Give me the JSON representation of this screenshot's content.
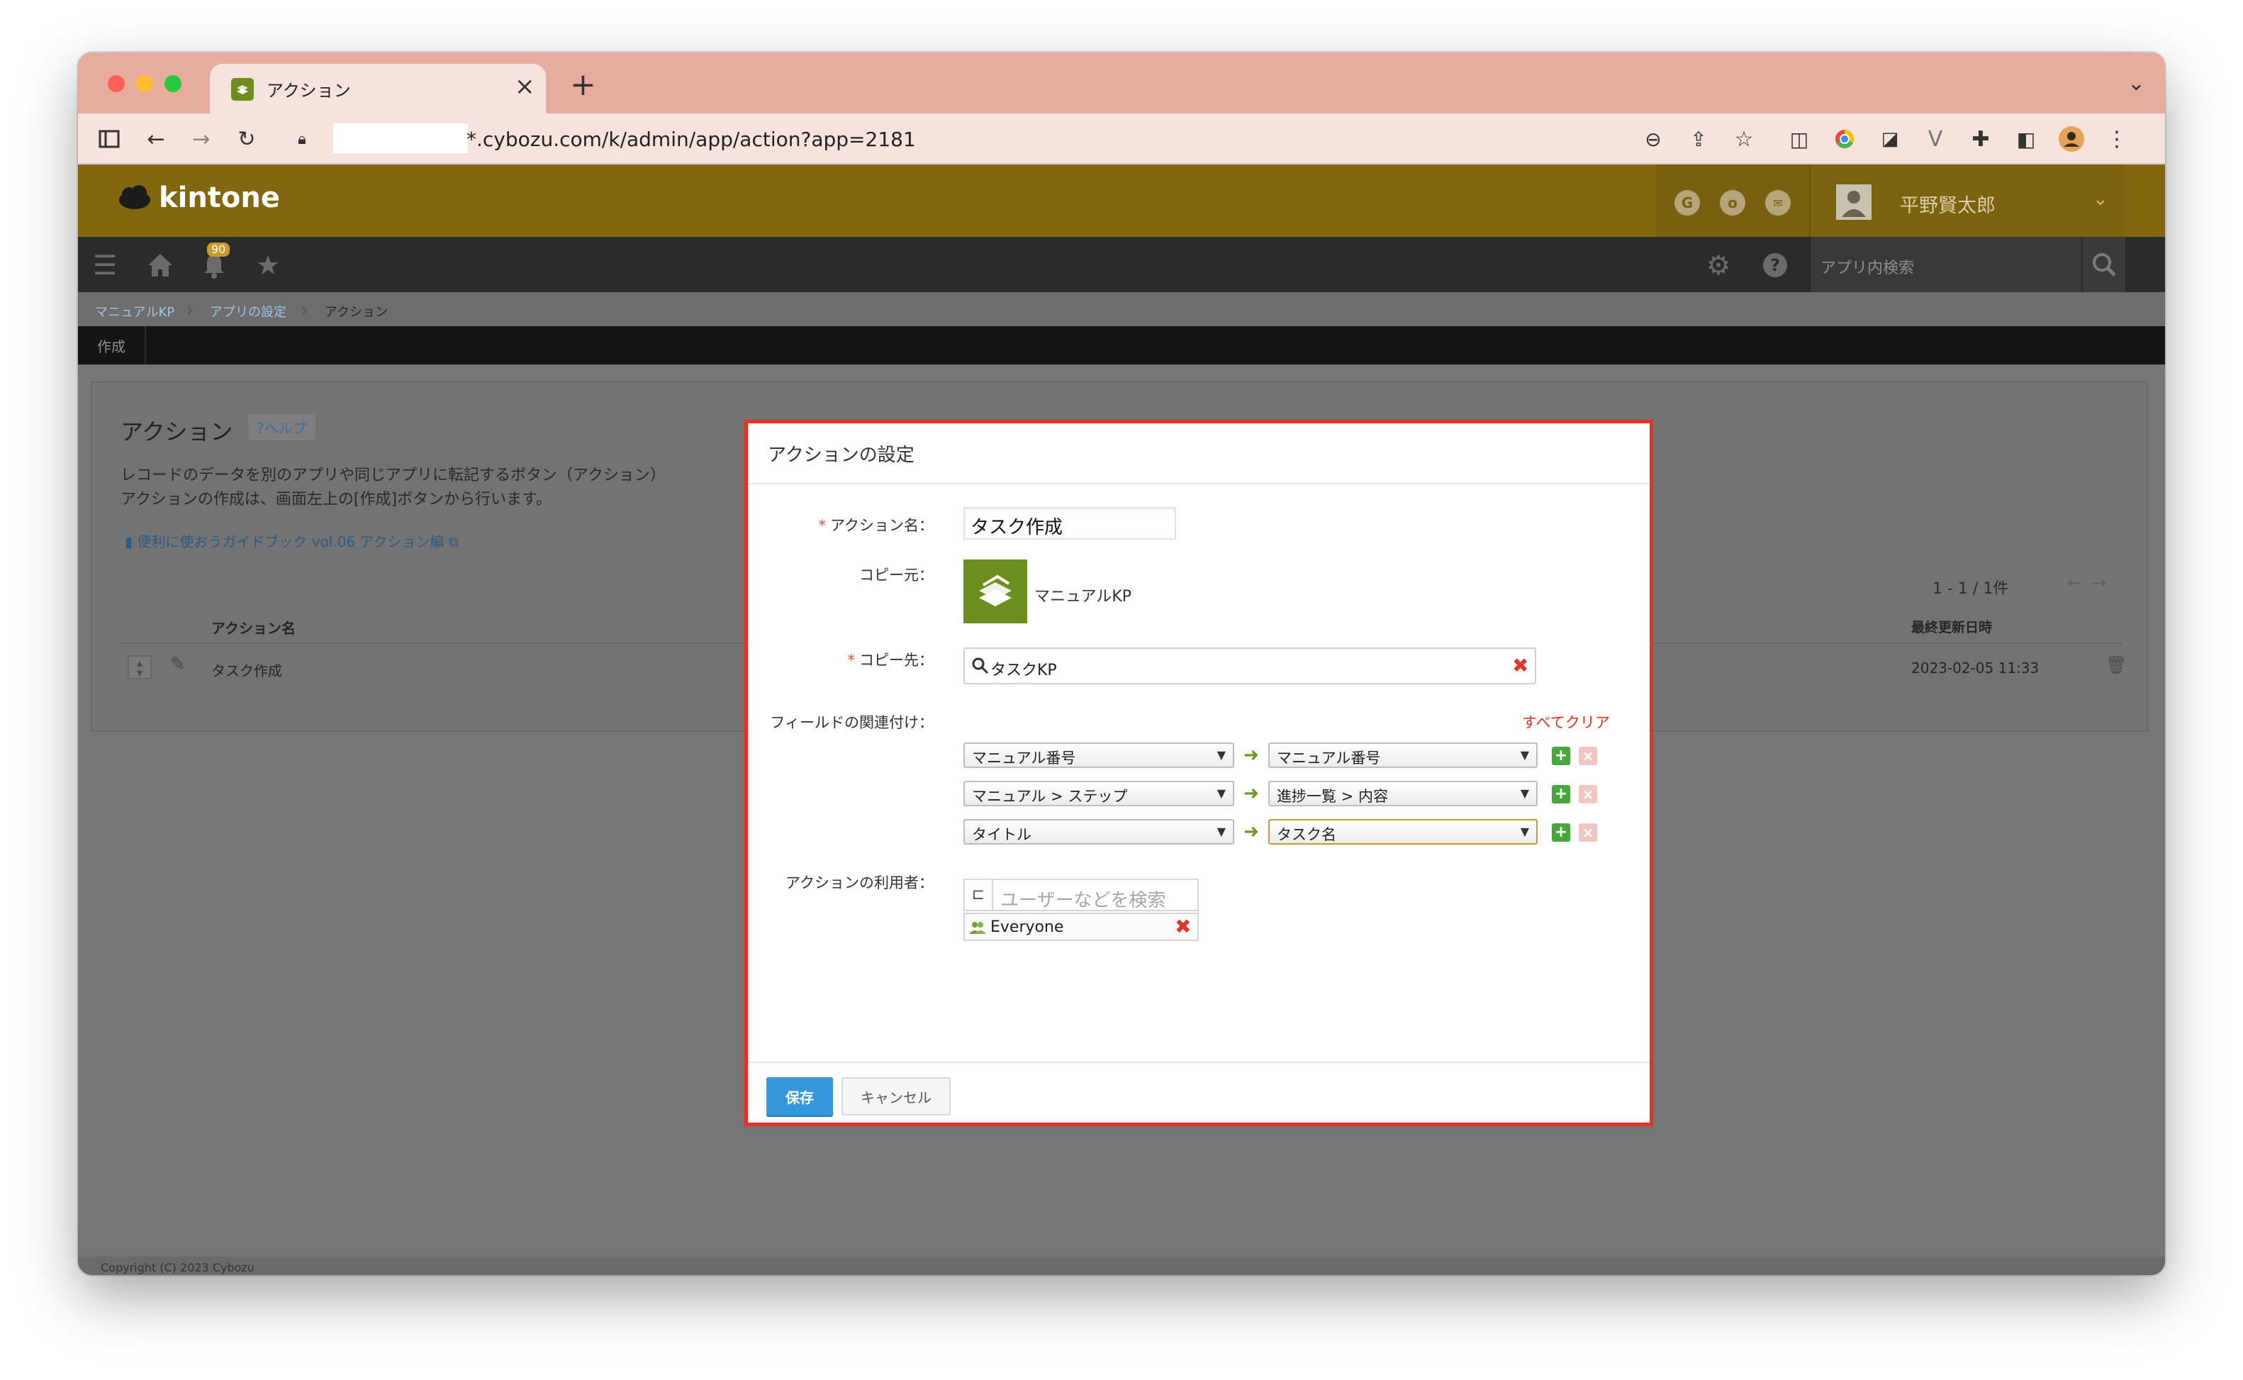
{
  "browser": {
    "tab_title": "アクション",
    "url": "*.cybozu.com/k/admin/app/action?app=2181",
    "icons": [
      "sidebar-icon",
      "back-icon",
      "forward-icon",
      "reload-icon",
      "lock-icon",
      "zoom-icon",
      "share-icon",
      "bookmark-star-icon",
      "reading-mode-icon",
      "chrome-ext-icon",
      "send-ext-icon",
      "vue-ext-icon",
      "extensions-icon",
      "side-panel-icon",
      "profile-icon",
      "more-icon"
    ]
  },
  "header": {
    "logo_text": "kintone",
    "user_name": "平野賢太郎",
    "header_icons": [
      "G",
      "o",
      "✉"
    ]
  },
  "nav": {
    "notification_count": "90",
    "search_placeholder": "アプリ内検索"
  },
  "breadcrumb": {
    "items": [
      "マニュアルKP",
      "アプリの設定",
      "アクション"
    ]
  },
  "actionbar": {
    "create_label": "作成"
  },
  "page": {
    "title": "アクション",
    "help_label": "?ヘルプ",
    "description_line1": "レコードのデータを別のアプリや同じアプリに転記するボタン（アクション）",
    "description_line2": "アクションの作成は、画面左上の[作成]ボタンから行います。",
    "guide_link": "便利に使おうガイドブック vol.06 アクション編",
    "pager": "1 - 1 / 1件",
    "table": {
      "col_name": "アクション名",
      "col_updated": "最終更新日時",
      "rows": [
        {
          "name": "タスク作成",
          "updated": "2023-02-05 11:33"
        }
      ]
    },
    "footer": "Copyright (C) 2023 Cybozu"
  },
  "modal": {
    "title": "アクションの設定",
    "action_name_label": "アクション名：",
    "action_name_value": "タスク作成",
    "copy_source_label": "コピー元：",
    "copy_source_app": "マニュアルKP",
    "copy_dest_label": "コピー先：",
    "copy_dest_value": "タスクKP",
    "field_mapping_label": "フィールドの関連付け：",
    "clear_all_label": "すべてクリア",
    "mappings": [
      {
        "from": "マニュアル番号",
        "to": "マニュアル番号"
      },
      {
        "from": "マニュアル > ステップ",
        "to": "進捗一覧 > 内容"
      },
      {
        "from": "タイトル",
        "to": "タスク名"
      }
    ],
    "users_label": "アクションの利用者：",
    "user_search_placeholder": "ユーザーなどを検索",
    "selected_user": "Everyone",
    "save_label": "保存",
    "cancel_label": "キャンセル"
  },
  "colors": {
    "kintone_header": "#826710",
    "modal_highlight_border": "#e53222",
    "save_button": "#3498db",
    "clear_all": "#e53222"
  }
}
